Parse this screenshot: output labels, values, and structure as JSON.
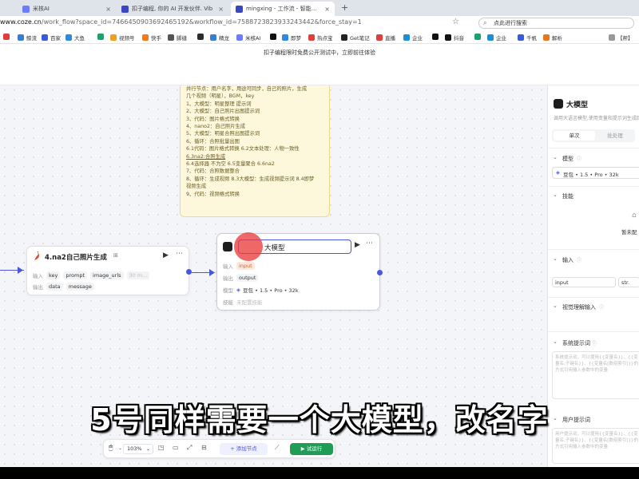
{
  "browser": {
    "tabs": [
      {
        "label": "米核AI",
        "active": false
      },
      {
        "label": "扣子编程, 你的 AI 开发伙伴. Vib",
        "active": false
      },
      {
        "label": "mingxing - 工作流 - 智能体平台",
        "active": true
      }
    ],
    "url_host": "www.coze.cn",
    "url_path": "/work_flow?space_id=7466450903692465192&workflow_id=7588723823933243442&force_stay=1",
    "search_placeholder": "点此进行搜索",
    "bookmarks": [
      "",
      "鲸流",
      "百家",
      "大鱼",
      "",
      "视频号",
      "快手",
      "脚缝",
      "",
      "精龙",
      "米核AI",
      "",
      "即梦",
      "热点宝",
      "Get笔记",
      "直播",
      "企业",
      "",
      "抖音",
      "",
      "企业",
      "千帆",
      "解析",
      "【帮】"
    ]
  },
  "banner": {
    "text": "扣子编程限时免费公开测试中，立即前往体验"
  },
  "note": {
    "lines": [
      "并行节点：用户名字，用途可同步，自己的照片，生成",
      "几个视频（明星），BGM，key",
      "1、大模型：明星整理 提示词",
      "2、大模型：自己照片出图提示词",
      "3、代码：图片格式转换",
      "4、nano2：自己照片生成",
      "5、大模型：明星合照出图提示词",
      "6、循环：合照批量出图",
      "  6.1代码：图片格式转换 6.2文本处理：人物一致性",
      "6.3na2:合照生成",
      "  6.4选择器 不为空 6.5变量聚合 6.6na2",
      "7、代码：合照数据整合",
      "8、循环：生成视频 8.3大模型：生成视频提示词 8.4即梦",
      "视频生成",
      "9、代码：视频格式转换"
    ]
  },
  "nodes": {
    "na2": {
      "title": "4.na2自己照片生成",
      "in_label": "输入",
      "out_label": "输出",
      "inputs": [
        "key",
        "prompt",
        "image_urls",
        "30 m..."
      ],
      "outputs": [
        "data",
        "message"
      ]
    },
    "llm": {
      "title_value": "大模型",
      "in_label": "输入",
      "out_label": "输出",
      "model_label": "模型",
      "skill_label": "技能",
      "input_tag": "input",
      "output_tag": "output",
      "model": "豆包 • 1.5 • Pro • 32k",
      "skill": "未配置技能"
    }
  },
  "panel": {
    "title": "大模型",
    "desc": "调用大语言模型,使用变量和提示词生成回复",
    "single_button": "单次",
    "batch_button": "批处理",
    "model_section": "模型",
    "model_value": "豆包 • 1.5 • Pro • 32k",
    "skill_section": "技能",
    "skill_empty": "暂未配",
    "input_section": "输入",
    "input_name": "input",
    "input_type": "str.",
    "vision_section": "视觉理解输入",
    "system_prompt_section": "系统提示词",
    "system_prompt_placeholder": "系统提示词，可以使用{{变量名}}、{{变量名.子键名}}、{{变量名[数组索引]}}的方式引用输入参数中的变量",
    "user_prompt_section": "用户提示词",
    "user_prompt_placeholder": "用户提示词，可以使用{{变量名}}、{{变量名.子键名}}、{{变量名[数组索引]}}的方式引用输入参数中的变量"
  },
  "toolbar": {
    "zoom": "103%",
    "add_node": "添加节点",
    "test_run": "试运行"
  },
  "subtitle": "5号同样需要一个大模型，改名字",
  "colors": {
    "accent": "#4a57d8",
    "run_green": "#1f9d55",
    "note_bg": "#fdf7dc"
  }
}
